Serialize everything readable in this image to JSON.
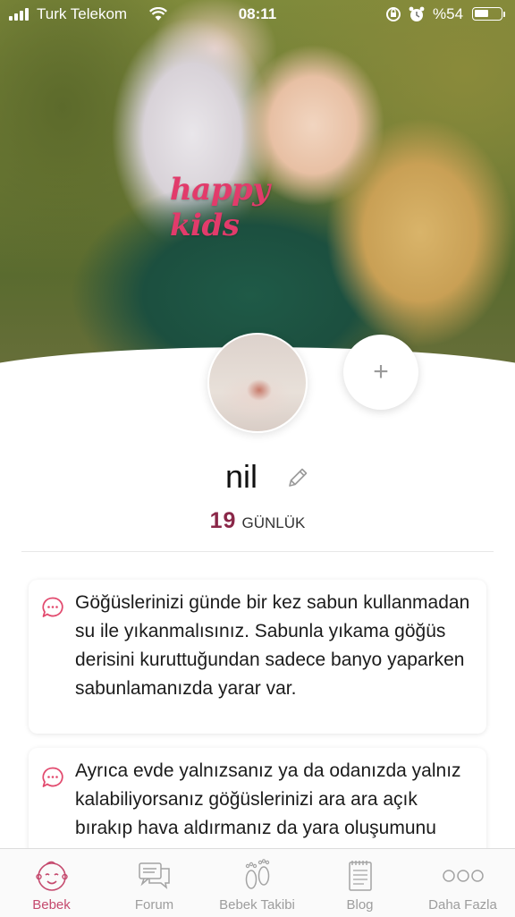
{
  "status_bar": {
    "carrier": "Turk Telekom",
    "time": "08:11",
    "battery": "%54",
    "battery_level": 0.54
  },
  "hero": {
    "logo": "happy kids"
  },
  "profile": {
    "name": "nil",
    "age_value": "19",
    "age_unit": "GÜNLÜK",
    "add_label": "+"
  },
  "tips": [
    {
      "text": "Göğüslerinizi günde bir kez sabun kullanmadan su ile yıkanmalısınız. Sabunla yıkama göğüs derisini kuruttuğundan sadece banyo yaparken sabunlamanızda yarar var."
    },
    {
      "text": "Ayrıca evde yalnızsanız ya da odanızda yalnız kalabiliyorsanız göğüslerinizi ara ara açık bırakıp hava aldırmanız da yara oluşumunu önlemek için iyi bir yöntem."
    }
  ],
  "tabbar": {
    "items": [
      {
        "label": "Bebek",
        "icon": "baby-face-icon",
        "active": true
      },
      {
        "label": "Forum",
        "icon": "chat-bubbles-icon",
        "active": false
      },
      {
        "label": "Bebek Takibi",
        "icon": "footprints-icon",
        "active": false
      },
      {
        "label": "Blog",
        "icon": "notepad-icon",
        "active": false
      },
      {
        "label": "Daha Fazla",
        "icon": "more-dots-icon",
        "active": false
      }
    ]
  },
  "colors": {
    "accent": "#c54a6e",
    "age_number": "#8a2748",
    "logo": "#e23b6b",
    "tab_inactive": "#9d9d9d"
  }
}
